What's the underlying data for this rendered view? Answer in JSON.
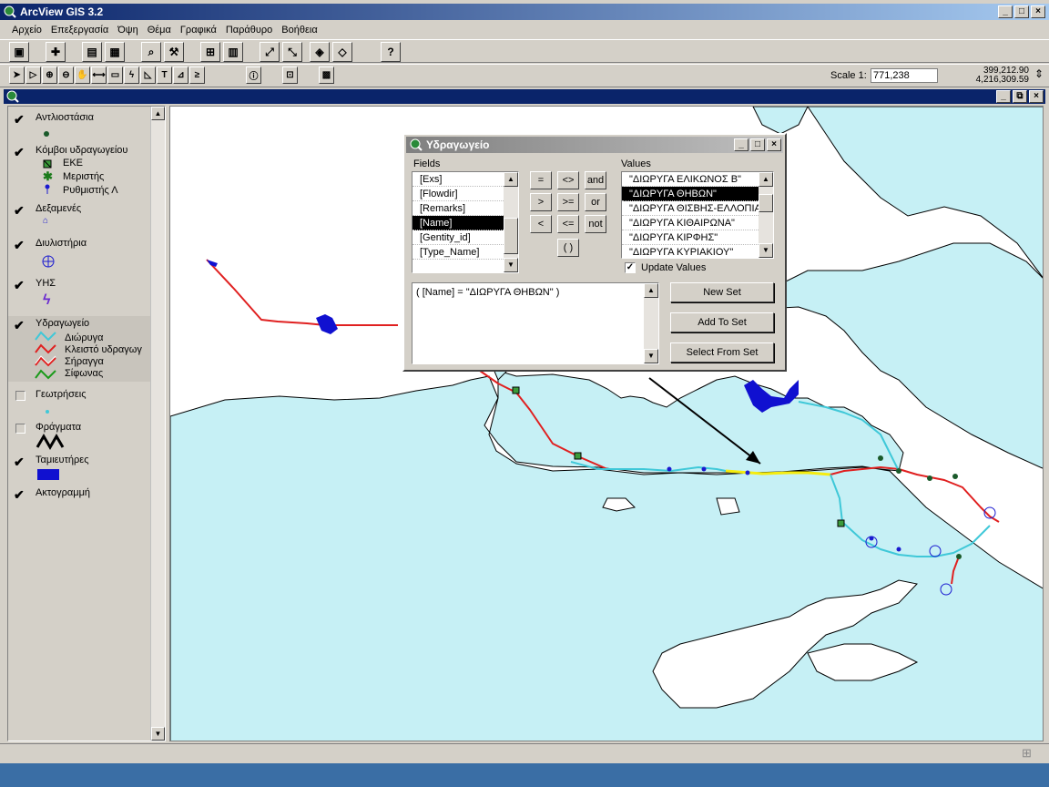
{
  "window": {
    "title": "ArcView GIS 3.2"
  },
  "menu": [
    "Αρχείο",
    "Επεξεργασία",
    "Όψη",
    "Θέμα",
    "Γραφικά",
    "Παράθυρο",
    "Βοήθεια"
  ],
  "toolbar": {
    "scale_label": "Scale 1:",
    "scale_value": "771,238",
    "coord_x": "399,212.90",
    "coord_y": "4,216,309.59"
  },
  "toc": {
    "layers": [
      {
        "name": "Αντλιοστάσια",
        "checked": true
      },
      {
        "name": "Κόμβοι υδραγωγείου",
        "checked": true,
        "legend": [
          "ΕΚΕ",
          "Μεριστής",
          "Ρυθμιστής Λ"
        ]
      },
      {
        "name": "Δεξαμενές",
        "checked": true
      },
      {
        "name": "Διυλιστήρια",
        "checked": true
      },
      {
        "name": "ΥΗΣ",
        "checked": true
      },
      {
        "name": "Υδραγωγείο",
        "checked": true,
        "legend": [
          "Διώρυγα",
          "Κλειστό υδραγωγ",
          "Σήραγγα",
          "Σίφωνας"
        ]
      },
      {
        "name": "Γεωτρήσεις",
        "checked": false
      },
      {
        "name": "Φράγματα",
        "checked": false
      },
      {
        "name": "Ταμιευτήρες",
        "checked": true
      },
      {
        "name": "Ακτογραμμή",
        "checked": true
      }
    ]
  },
  "dialog": {
    "title": "Υδραγωγείο",
    "fields_label": "Fields",
    "values_label": "Values",
    "fields": [
      "[Exs]",
      "[Flowdir]",
      "[Remarks]",
      "[Name]",
      "[Gentity_id]",
      "[Type_Name]"
    ],
    "selected_field": "[Name]",
    "values": [
      "\"ΔΙΩΡΥΓΑ ΕΛΙΚΩΝΟΣ Β\"",
      "\"ΔΙΩΡΥΓΑ ΘΗΒΩΝ\"",
      "\"ΔΙΩΡΥΓΑ ΘΙΣΒΗΣ-ΕΛΛΟΠΙΑΣ",
      "\"ΔΙΩΡΥΓΑ ΚΙΘΑΙΡΩΝΑ\"",
      "\"ΔΙΩΡΥΓΑ ΚΙΡΦΗΣ\"",
      "\"ΔΙΩΡΥΓΑ ΚΥΡΙΑΚΙΟΥ\""
    ],
    "selected_value": "\"ΔΙΩΡΥΓΑ ΘΗΒΩΝ\"",
    "operators": [
      "=",
      "<>",
      "and",
      ">",
      ">=",
      "or",
      "<",
      "<=",
      "not",
      "( )"
    ],
    "update_values_label": "Update Values",
    "update_values_checked": true,
    "expression": "( [Name] = \"ΔΙΩΡΥΓΑ ΘΗΒΩΝ\" )",
    "new_set": "New Set",
    "add_to_set": "Add To Set",
    "select_from_set": "Select From Set"
  },
  "colors": {
    "water": "#c6f0f5",
    "canal": "#3fc8d8",
    "closed": "#e02020",
    "selected": "#f5ec10",
    "reservoir": "#1010d0",
    "titlebar": "#0a246a"
  }
}
